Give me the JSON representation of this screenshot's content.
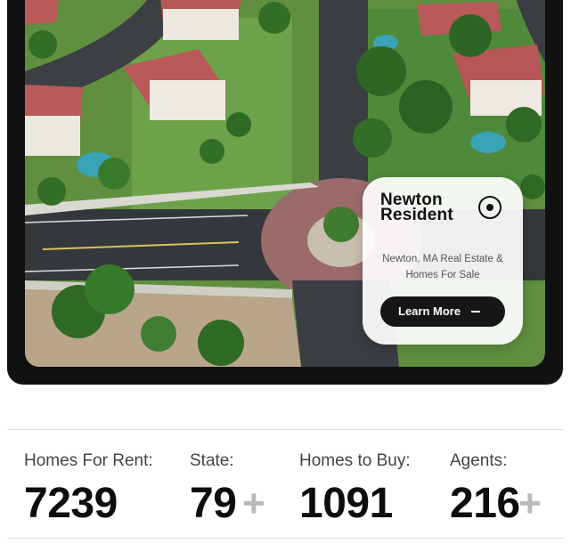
{
  "hero": {
    "image_description_icon": "aerial-neighborhood-photo",
    "card": {
      "title": "Newton Resident",
      "description": "Newton, MA Real Estate & Homes For Sale",
      "button_label": "Learn More"
    }
  },
  "stats": [
    {
      "label": "Homes For Rent:",
      "value": "7239",
      "suffix": ""
    },
    {
      "label": "State:",
      "value": "79",
      "suffix": "+"
    },
    {
      "label": "Homes to Buy:",
      "value": "1091",
      "suffix": ""
    },
    {
      "label": "Agents:",
      "value": "216",
      "suffix": "+"
    }
  ],
  "colors": {
    "frame": "#111111",
    "button": "#161616",
    "suffix": "#b9b9b9"
  }
}
